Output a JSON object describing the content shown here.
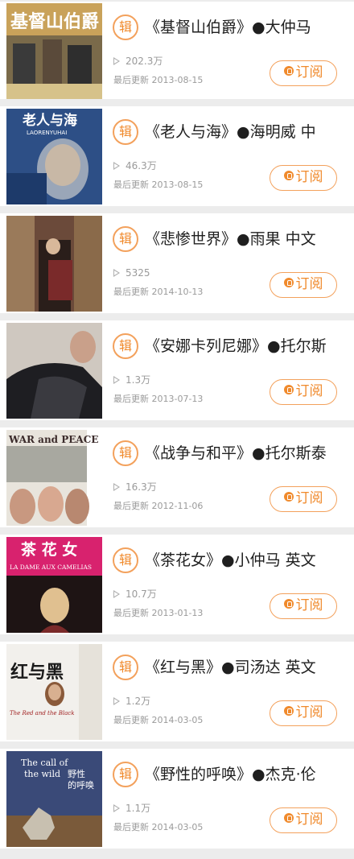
{
  "items": [
    {
      "badge": "辑",
      "title": "《基督山伯爵》●大仲马",
      "plays": "202.3万",
      "updated": "最后更新 2013-08-15",
      "subscribe": "订阅",
      "cover": {
        "name": "count-of-monte-cristo-cover",
        "text": "基督山伯爵",
        "bg": "#c9a25a"
      }
    },
    {
      "badge": "辑",
      "title": "《老人与海》●海明威 中",
      "plays": "46.3万",
      "updated": "最后更新 2013-08-15",
      "subscribe": "订阅",
      "cover": {
        "name": "old-man-and-the-sea-cover",
        "text": "老人与海",
        "sub": "LAORENYUHAI",
        "bg": "#2d4f86"
      }
    },
    {
      "badge": "辑",
      "title": "《悲惨世界》●雨果 中文",
      "plays": "5325",
      "updated": "最后更新 2014-10-13",
      "subscribe": "订阅",
      "cover": {
        "name": "les-miserables-cover",
        "bg": "#6b4a3a"
      }
    },
    {
      "badge": "辑",
      "title": "《安娜卡列尼娜》●托尔斯",
      "plays": "1.3万",
      "updated": "最后更新 2013-07-13",
      "subscribe": "订阅",
      "cover": {
        "name": "anna-karenina-cover",
        "bg": "#cfc8c0"
      }
    },
    {
      "badge": "辑",
      "title": "《战争与和平》●托尔斯泰",
      "plays": "16.3万",
      "updated": "最后更新 2012-11-06",
      "subscribe": "订阅",
      "cover": {
        "name": "war-and-peace-cover",
        "text": "WAR and PEACE",
        "bg": "#e8e4dc"
      }
    },
    {
      "badge": "辑",
      "title": "《茶花女》●小仲马 英文",
      "plays": "10.7万",
      "updated": "最后更新 2013-01-13",
      "subscribe": "订阅",
      "cover": {
        "name": "camille-cover",
        "text": "茶 花 女",
        "sub": "LA DAME AUX CAMELIAS",
        "bg": "#d8226e"
      }
    },
    {
      "badge": "辑",
      "title": "《红与黑》●司汤达 英文",
      "plays": "1.2万",
      "updated": "最后更新 2014-03-05",
      "subscribe": "订阅",
      "cover": {
        "name": "red-and-black-cover",
        "text": "红与黑",
        "sub": "The Red and the Black",
        "bg": "#f2f0ec"
      }
    },
    {
      "badge": "辑",
      "title": "《野性的呼唤》●杰克·伦",
      "plays": "1.1万",
      "updated": "最后更新 2014-03-05",
      "subscribe": "订阅",
      "cover": {
        "name": "call-of-the-wild-cover",
        "text": "The call of the wild",
        "sub": "野性的呼唤",
        "bg": "#3a4a78"
      }
    }
  ],
  "colors": {
    "accent": "#f08a2c",
    "accent_light": "#f3a15c",
    "text": "#1f1f1f",
    "muted": "#9a9a9a",
    "bg": "#ececec"
  }
}
